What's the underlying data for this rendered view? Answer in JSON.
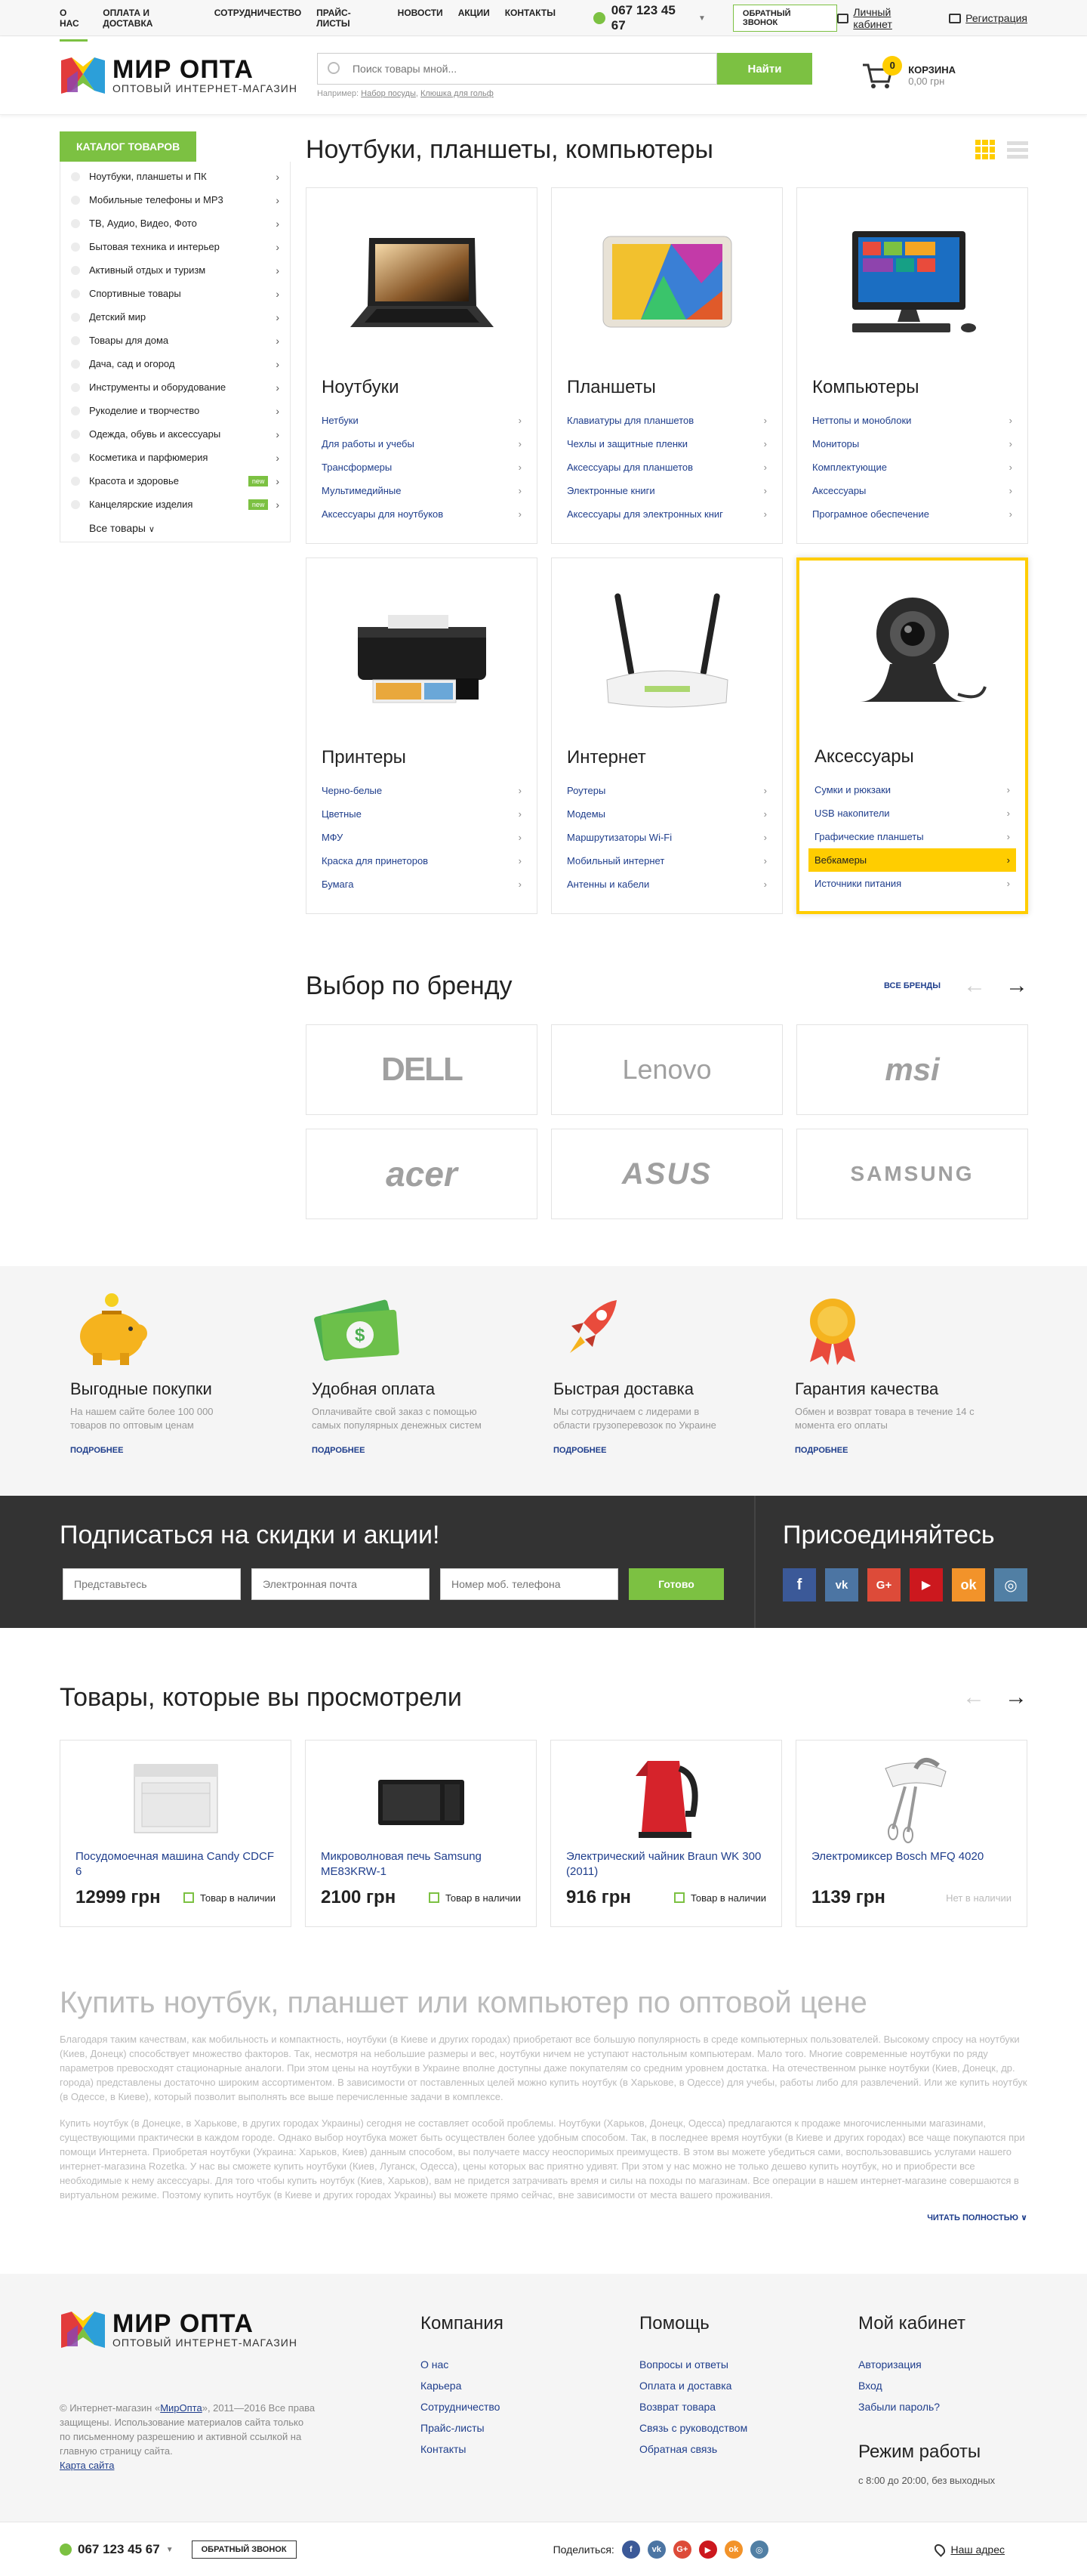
{
  "topnav": {
    "items": [
      "О нас",
      "Оплата и доставка",
      "Сотрудничество",
      "Прайс-листы",
      "Новости",
      "Акции",
      "Контакты"
    ],
    "phone": "067 123 45 67",
    "callback": "Обратный звонок",
    "account": "Личный кабинет",
    "register": "Регистрация"
  },
  "header": {
    "logo_title": "МИР ОПТА",
    "logo_sub": "ОПТОВЫЙ ИНТЕРНЕТ-МАГАЗИН",
    "search_placeholder": "Поиск товары мной...",
    "search_button": "Найти",
    "hint_prefix": "Например:",
    "hint_1": "Набор посуды",
    "hint_2": "Клюшка для гольф",
    "cart_label": "Корзина",
    "cart_count": "0",
    "cart_sum": "0,00 грн"
  },
  "sidebar": {
    "button": "Каталог товаров",
    "items": [
      {
        "label": "Ноутбуки, планшеты и ПК",
        "badge": ""
      },
      {
        "label": "Мобильные телефоны и MP3",
        "badge": ""
      },
      {
        "label": "ТВ, Аудио, Видео, Фото",
        "badge": ""
      },
      {
        "label": "Бытовая техника и интерьер",
        "badge": ""
      },
      {
        "label": "Активный отдых и туризм",
        "badge": ""
      },
      {
        "label": "Спортивные товары",
        "badge": ""
      },
      {
        "label": "Детский мир",
        "badge": ""
      },
      {
        "label": "Товары для дома",
        "badge": ""
      },
      {
        "label": "Дача, сад и огород",
        "badge": ""
      },
      {
        "label": "Инструменты и оборудование",
        "badge": ""
      },
      {
        "label": "Рукоделие и творчество",
        "badge": ""
      },
      {
        "label": "Одежда, обувь и аксессуары",
        "badge": ""
      },
      {
        "label": "Косметика и парфюмерия",
        "badge": ""
      },
      {
        "label": "Красота и здоровье",
        "badge": "new"
      },
      {
        "label": "Канцелярские изделия",
        "badge": "new"
      }
    ],
    "all": "Все товары"
  },
  "main": {
    "title": "Ноутбуки, планшеты, компьютеры",
    "categories": [
      {
        "name": "Ноутбуки",
        "subs": [
          "Нетбуки",
          "Для работы и учебы",
          "Трансформеры",
          "Мультимедийные",
          "Аксессуары для ноутбуков"
        ]
      },
      {
        "name": "Планшеты",
        "subs": [
          "Клавиатуры для планшетов",
          "Чехлы и защитные пленки",
          "Аксессуары для планшетов",
          "Электронные книги",
          "Аксессуары для электронных книг"
        ]
      },
      {
        "name": "Компьютеры",
        "subs": [
          "Неттопы и моноблоки",
          "Мониторы",
          "Комплектующие",
          "Аксессуары",
          "Програмное обеспечение"
        ]
      },
      {
        "name": "Принтеры",
        "subs": [
          "Черно-белые",
          "Цветные",
          "МФУ",
          "Краска для принеторов",
          "Бумага"
        ]
      },
      {
        "name": "Интернет",
        "subs": [
          "Роутеры",
          "Модемы",
          "Маршрутизаторы Wi-Fi",
          "Мобильный интернет",
          "Антенны и кабели"
        ]
      },
      {
        "name": "Аксессуары",
        "subs": [
          "Сумки и рюкзаки",
          "USB накопители",
          "Графические планшеты",
          "Вебкамеры",
          "Источники питания"
        ]
      }
    ],
    "brand_title": "Выбор по бренду",
    "brand_all": "Все бренды",
    "brands": [
      "DELL",
      "Lenovo",
      "msi",
      "acer",
      "ASUS",
      "SAMSUNG"
    ]
  },
  "advantages": [
    {
      "title": "Выгодные покупки",
      "desc": "На нашем сайте более 100 000 товаров по оптовым ценам",
      "more": "Подробнее"
    },
    {
      "title": "Удобная оплата",
      "desc": "Оплачивайте свой заказ с помощью самых популярных денежных систем",
      "more": "Подробнее"
    },
    {
      "title": "Быстрая доставка",
      "desc": "Мы сотрудничаем с лидерами в области грузоперевозок по Украине",
      "more": "Подробнее"
    },
    {
      "title": "Гарантия качества",
      "desc": "Обмен и возврат товара в течение 14 с момента его оплаты",
      "more": "Подробнее"
    }
  ],
  "subscribe": {
    "title": "Подписаться на скидки и акции!",
    "name_placeholder": "Представьтесь",
    "email_placeholder": "Электронная почта",
    "phone_placeholder": "Номер моб. телефона",
    "button": "Готово",
    "join_title": "Присоединяйтесь"
  },
  "viewed": {
    "title": "Товары, которые вы просмотрели",
    "products": [
      {
        "name": "Посудомоечная машина Candy CDCF 6",
        "price": "12999 грн",
        "stock": "Товар в наличии"
      },
      {
        "name": "Микроволновая печь Samsung ME83KRW-1",
        "price": "2100 грн",
        "stock": "Товар в наличии"
      },
      {
        "name": "Электрический чайник Braun WK 300 (2011)",
        "price": "916 грн",
        "stock": "Товар в наличии"
      },
      {
        "name": "Электромиксер Bosch MFQ 4020",
        "price": "1139 грн",
        "stock": "Нет в наличии"
      }
    ]
  },
  "seo": {
    "title": "Купить ноутбук, планшет или компьютер по оптовой цене",
    "p1": "Благодаря таким качествам, как мобильность и компактность, ноутбуки (в Киеве и других городах) приобретают все большую популярность в среде компьютерных пользователей. Высокому спросу на ноутбуки (Киев, Донецк) способствует множество факторов. Так, несмотря на небольшие размеры и вес, ноутбуки ничем не уступают настольным компьютерам. Мало того. Многие современные ноутбуки по ряду параметров превосходят стационарные аналоги. При этом цены на ноутбуки в Украине вполне доступны даже покупателям со средним уровнем достатка. На отечественном рынке ноутбуки (Киев, Донецк, др. города) представлены достаточно широким ассортиментом. В зависимости от поставленных целей можно купить ноутбук (в Харькове, в Одессе) для учебы, работы либо для развлечений. Или же купить ноутбук (в Одессе, в Киеве), который позволит выполнять все выше перечисленные задачи в комплексе.",
    "p2": "Купить ноутбук (в Донецке, в Харькове, в других городах Украины) сегодня не составляет особой проблемы. Ноутбуки (Харьков, Донецк, Одесса) предлагаются к продаже многочисленными магазинами, существующими практически в каждом городе. Однако выбор ноутбука может быть осуществлен более удобным способом. Так, в последнее время ноутбуки (в Киеве и других городах) все чаще покупаются при помощи Интернета. Приобретая ноутбуки (Украина: Харьков, Киев) данным способом, вы получаете массу неоспоримых преимуществ. В этом вы можете убедиться сами, воспользовавшись услугами нашего интернет-магазина Rozetka. У нас вы сможете купить ноутбуки (Киев, Луганск, Одесса), цены которых вас приятно удивят. При этом у нас можно не только дешево купить ноутбук, но и приобрести все необходимые к нему аксессуары. Для того чтобы купить ноутбук (Киев, Харьков), вам не придется затрачивать время и силы на походы по магазинам. Все операции в нашем интернет-магазине совершаются в виртуальном режиме. Поэтому купить ноутбук (в Киеве и других городах Украины) вы можете прямо сейчас, вне зависимости от места вашего проживания.",
    "more": "Читать полностью"
  },
  "footer": {
    "logo_title": "МИР ОПТА",
    "logo_sub": "ОПТОВЫЙ ИНТЕРНЕТ-МАГАЗИН",
    "copy_1": "© Интернет-магазин «",
    "copy_brand": "МирОпта",
    "copy_2": "», 2011—2016 Все права защищены. Использование материалов сайта только по письменному разрешению и активной ссылкой на главную страницу сайта.",
    "sitemap": "Карта сайта",
    "col1": {
      "title": "Компания",
      "links": [
        "О нас",
        "Карьера",
        "Сотрудничество",
        "Прайс-листы",
        "Контакты"
      ]
    },
    "col2": {
      "title": "Помощь",
      "links": [
        "Вопросы и ответы",
        "Оплата и доставка",
        "Возврат товара",
        "Связь с руководством",
        "Обратная связь"
      ]
    },
    "col3": {
      "title": "Мой кабинет",
      "links": [
        "Авторизация",
        "Вход",
        "Забыли пароль?"
      ]
    },
    "hours_title": "Режим работы",
    "hours": "с 8:00 до 20:00, без выходных"
  },
  "bottombar": {
    "phone": "067 123 45 67",
    "callback": "Обратный звонок",
    "share": "Поделиться:",
    "address": "Наш адрес"
  },
  "colors": {
    "accent": "#7cc142",
    "highlight": "#ffcd00",
    "link": "#1f3e8c",
    "dark": "#333333"
  }
}
